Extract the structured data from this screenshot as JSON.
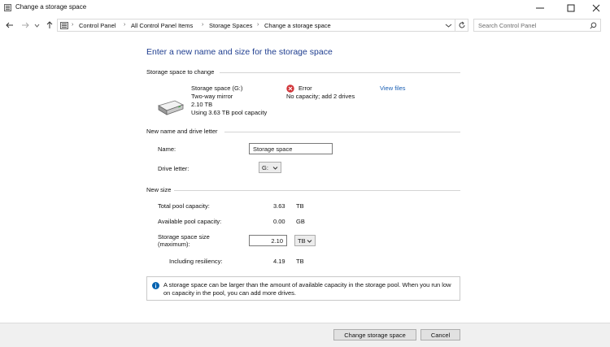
{
  "window": {
    "title": "Change a storage space"
  },
  "address_bar": {
    "breadcrumbs": [
      "Control Panel",
      "All Control Panel Items",
      "Storage Spaces",
      "Change a storage space"
    ],
    "search_placeholder": "Search Control Panel"
  },
  "page": {
    "heading": "Enter a new name and size for the storage space",
    "space_to_change": {
      "section_title": "Storage space to change",
      "name": "Storage space (G:)",
      "resiliency": "Two-way mirror",
      "size": "2.10 TB",
      "usage": "Using 3.63 TB pool capacity",
      "status": "Error",
      "status_detail": "No capacity; add 2 drives",
      "view_files_link": "View files"
    },
    "name_section": {
      "section_title": "New name and drive letter",
      "name_label": "Name:",
      "name_value": "Storage space",
      "drive_letter_label": "Drive letter:",
      "drive_letter_value": "G:"
    },
    "size_section": {
      "section_title": "New size",
      "total_label": "Total pool capacity:",
      "total_value": "3.63",
      "total_unit": "TB",
      "available_label": "Available pool capacity:",
      "available_value": "0.00",
      "available_unit": "GB",
      "size_label": "Storage space size (maximum):",
      "size_value": "2.10",
      "size_unit": "TB",
      "resiliency_label": "Including resiliency:",
      "resiliency_value": "4.19",
      "resiliency_unit": "TB"
    },
    "info_text": "A storage space can be larger than the amount of available capacity in the storage pool. When you run low on capacity in the pool, you can add more drives."
  },
  "footer": {
    "change_label": "Change storage space",
    "cancel_label": "Cancel"
  },
  "colors": {
    "heading": "#1e3d8f",
    "link": "#1a5fb4",
    "error_red": "#d13438",
    "info_blue": "#0063b1"
  },
  "icons": [
    "app-icon",
    "minimize-icon",
    "maximize-icon",
    "close-icon",
    "back-arrow-icon",
    "forward-arrow-icon",
    "recent-dropdown-icon",
    "up-arrow-icon",
    "control-panel-icon",
    "refresh-icon",
    "search-icon",
    "drive-icon",
    "error-icon",
    "info-icon",
    "chevron-down-icon"
  ]
}
